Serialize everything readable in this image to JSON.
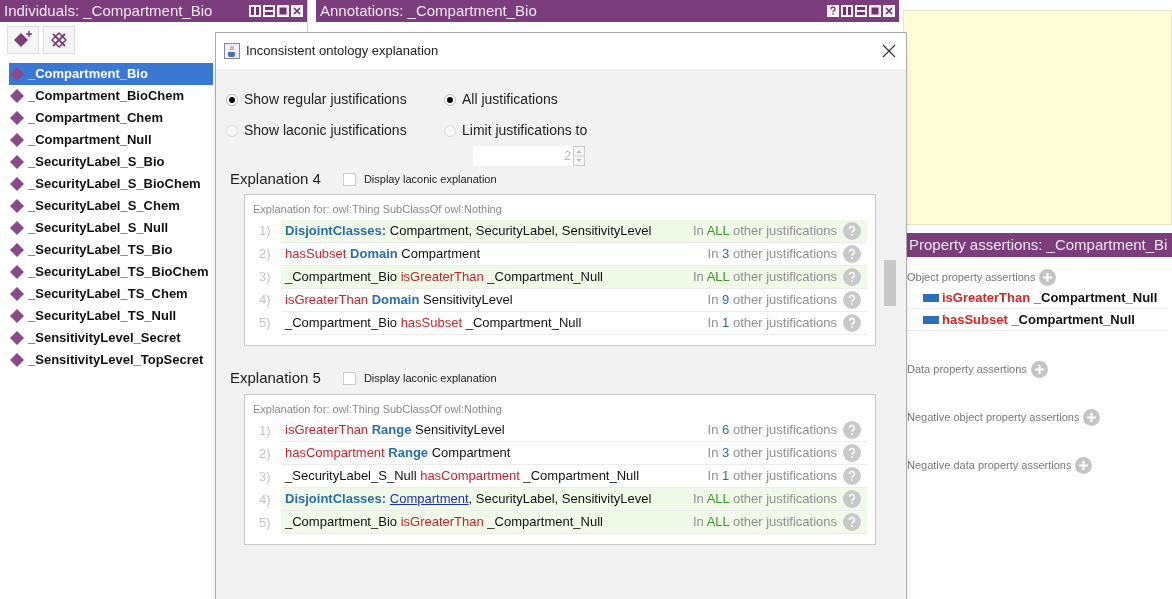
{
  "individuals_panel": {
    "title": "Individuals: _Compartment_Bio",
    "items": [
      {
        "label": "_Compartment_Bio",
        "selected": true
      },
      {
        "label": "_Compartment_BioChem",
        "selected": false
      },
      {
        "label": "_Compartment_Chem",
        "selected": false
      },
      {
        "label": "_Compartment_Null",
        "selected": false
      },
      {
        "label": "_SecurityLabel_S_Bio",
        "selected": false
      },
      {
        "label": "_SecurityLabel_S_BioChem",
        "selected": false
      },
      {
        "label": "_SecurityLabel_S_Chem",
        "selected": false
      },
      {
        "label": "_SecurityLabel_S_Null",
        "selected": false
      },
      {
        "label": "_SecurityLabel_TS_Bio",
        "selected": false
      },
      {
        "label": "_SecurityLabel_TS_BioChem",
        "selected": false
      },
      {
        "label": "_SecurityLabel_TS_Chem",
        "selected": false
      },
      {
        "label": "_SecurityLabel_TS_Null",
        "selected": false
      },
      {
        "label": "_SensitivityLevel_Secret",
        "selected": false
      },
      {
        "label": "_SensitivityLevel_TopSecret",
        "selected": false
      }
    ]
  },
  "annotations_panel": {
    "title": "Annotations: _Compartment_Bio"
  },
  "dialog": {
    "title": "Inconsistent ontology explanation",
    "justification_mode": [
      {
        "label": "Show regular justifications",
        "selected": true
      },
      {
        "label": "Show laconic justifications",
        "selected": false
      }
    ],
    "limit_mode": [
      {
        "label": "All justifications",
        "selected": true
      },
      {
        "label": "Limit justifications to",
        "selected": false
      }
    ],
    "limit_value": "2",
    "explanations": [
      {
        "title": "Explanation 4",
        "laconic_label": "Display laconic explanation",
        "laconic_checked": false,
        "subtitle": "Explanation for: owl:Thing SubClassOf owl:Nothing",
        "axioms": [
          {
            "number": "1)",
            "segments": [
              {
                "kind": "keyword",
                "text": "DisjointClasses:"
              },
              {
                "kind": "entity",
                "text": "Compartment, SecurityLabel, SensitivityLevel"
              }
            ],
            "count_prefix": "In",
            "count": "ALL",
            "count_suffix": "other justifications",
            "shared": true
          },
          {
            "number": "2)",
            "segments": [
              {
                "kind": "property",
                "text": "hasSubset"
              },
              {
                "kind": "keyword",
                "text": "Domain"
              },
              {
                "kind": "entity",
                "text": "Compartment"
              }
            ],
            "count_prefix": "In",
            "count": "3",
            "count_suffix": "other justifications",
            "shared": false
          },
          {
            "number": "3)",
            "segments": [
              {
                "kind": "entity",
                "text": "_Compartment_Bio"
              },
              {
                "kind": "property",
                "text": "isGreaterThan"
              },
              {
                "kind": "entity",
                "text": "_Compartment_Null"
              }
            ],
            "count_prefix": "In",
            "count": "ALL",
            "count_suffix": "other justifications",
            "shared": true
          },
          {
            "number": "4)",
            "segments": [
              {
                "kind": "property",
                "text": "isGreaterThan"
              },
              {
                "kind": "keyword",
                "text": "Domain"
              },
              {
                "kind": "entity",
                "text": "SensitivityLevel"
              }
            ],
            "count_prefix": "In",
            "count": "9",
            "count_suffix": "other justifications",
            "shared": false
          },
          {
            "number": "5)",
            "segments": [
              {
                "kind": "entity",
                "text": "_Compartment_Bio"
              },
              {
                "kind": "property",
                "text": "hasSubset"
              },
              {
                "kind": "entity",
                "text": "_Compartment_Null"
              }
            ],
            "count_prefix": "In",
            "count": "1",
            "count_suffix": "other justifications",
            "shared": false
          }
        ]
      },
      {
        "title": "Explanation 5",
        "laconic_label": "Display laconic explanation",
        "laconic_checked": false,
        "subtitle": "Explanation for: owl:Thing SubClassOf owl:Nothing",
        "axioms": [
          {
            "number": "1)",
            "segments": [
              {
                "kind": "property",
                "text": "isGreaterThan"
              },
              {
                "kind": "keyword",
                "text": "Range"
              },
              {
                "kind": "entity",
                "text": "SensitivityLevel"
              }
            ],
            "count_prefix": "In",
            "count": "6",
            "count_suffix": "other justifications",
            "shared": false
          },
          {
            "number": "2)",
            "segments": [
              {
                "kind": "property",
                "text": "hasCompartment"
              },
              {
                "kind": "keyword",
                "text": "Range"
              },
              {
                "kind": "entity",
                "text": "Compartment"
              }
            ],
            "count_prefix": "In",
            "count": "3",
            "count_suffix": "other justifications",
            "shared": false
          },
          {
            "number": "3)",
            "segments": [
              {
                "kind": "entity",
                "text": "_SecurityLabel_S_Null"
              },
              {
                "kind": "property",
                "text": "hasCompartment"
              },
              {
                "kind": "entity",
                "text": "_Compartment_Null"
              }
            ],
            "count_prefix": "In",
            "count": "1",
            "count_suffix": "other justifications",
            "shared": false
          },
          {
            "number": "4)",
            "segments": [
              {
                "kind": "keyword",
                "text": "DisjointClasses:"
              },
              {
                "kind": "link",
                "text": "Compartment"
              },
              {
                "kind": "entity",
                "text": ", SecurityLabel, SensitivityLevel",
                "attached": true
              }
            ],
            "count_prefix": "In",
            "count": "ALL",
            "count_suffix": "other justifications",
            "shared": true
          },
          {
            "number": "5)",
            "segments": [
              {
                "kind": "entity",
                "text": "_Compartment_Bio"
              },
              {
                "kind": "property",
                "text": "isGreaterThan"
              },
              {
                "kind": "entity",
                "text": "_Compartment_Null"
              }
            ],
            "count_prefix": "In",
            "count": "ALL",
            "count_suffix": "other justifications",
            "shared": true
          }
        ]
      }
    ]
  },
  "property_panel": {
    "title": "Property assertions: _Compartment_Bi",
    "sections": [
      {
        "label": "Object property assertions",
        "items": [
          {
            "property": "isGreaterThan",
            "value": "_Compartment_Null"
          },
          {
            "property": "hasSubset",
            "value": "_Compartment_Null"
          }
        ]
      },
      {
        "label": "Data property assertions"
      },
      {
        "label": "Negative object property assertions"
      },
      {
        "label": "Negative data property assertions"
      }
    ]
  }
}
